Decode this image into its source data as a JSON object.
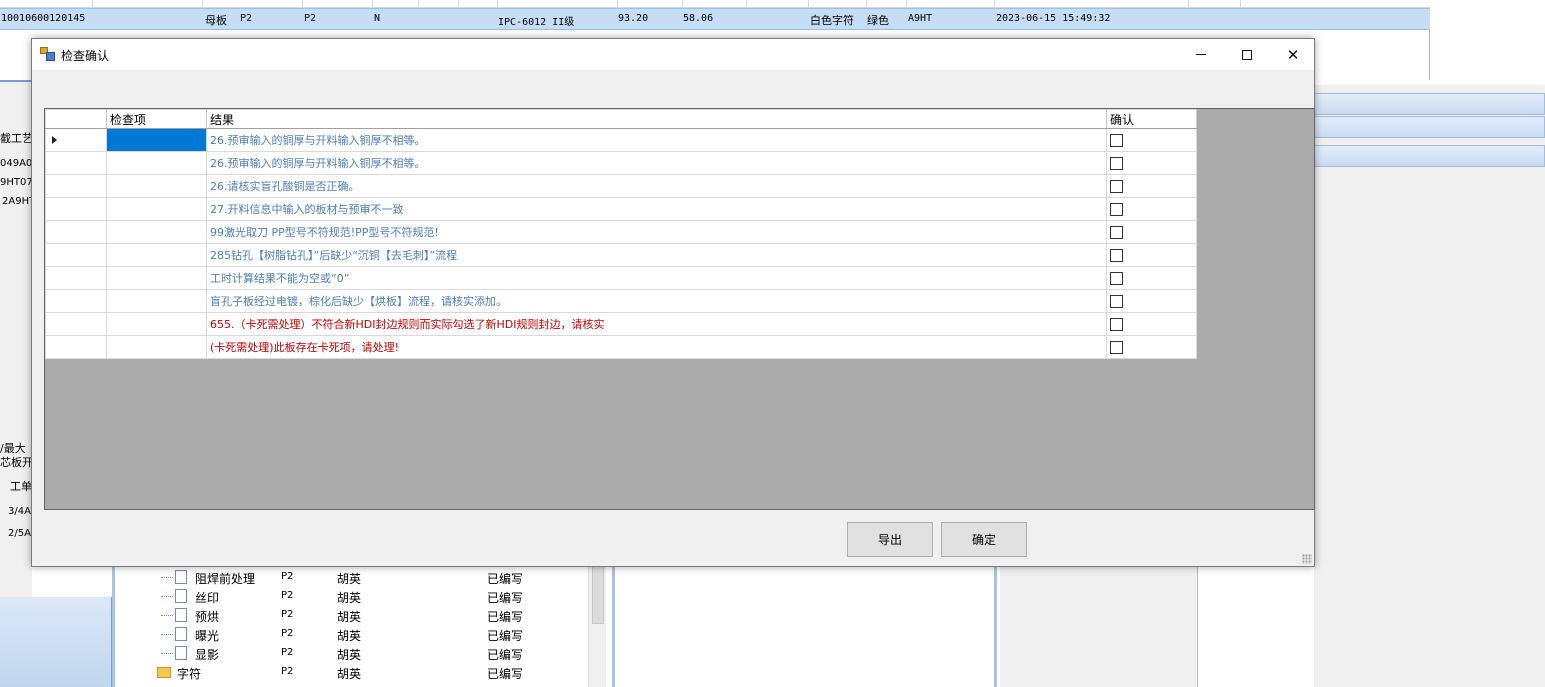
{
  "background": {
    "top_row": {
      "id": "10010600120145",
      "type": "母板",
      "c1": "P2",
      "c2": "P2",
      "c3": "N",
      "standard": "IPC-6012 II级",
      "v1": "93.20",
      "v2": "58.06",
      "ink": "白色字符",
      "color": "绿色",
      "code": "A9HT",
      "datetime": "2023-06-15 15:49:32"
    },
    "left_texts": [
      "截工艺",
      "049A0",
      "9HT07",
      "2A9HT",
      "/最大",
      "芯板开",
      "工单",
      "3/4A",
      "2/5A"
    ],
    "tree_rows": [
      {
        "label": "阻焊前处理",
        "c1": "P2",
        "c2": "胡英",
        "c3": "已编写"
      },
      {
        "label": "丝印",
        "c1": "P2",
        "c2": "胡英",
        "c3": "已编写"
      },
      {
        "label": "预烘",
        "c1": "P2",
        "c2": "胡英",
        "c3": "已编写"
      },
      {
        "label": "曝光",
        "c1": "P2",
        "c2": "胡英",
        "c3": "已编写"
      },
      {
        "label": "显影",
        "c1": "P2",
        "c2": "胡英",
        "c3": "已编写"
      },
      {
        "label": "字符",
        "c1": "P2",
        "c2": "胡英",
        "c3": "已编写"
      }
    ]
  },
  "dialog": {
    "title": "检查确认",
    "window_controls": {
      "minimize": "minimize-icon",
      "maximize": "maximize-icon",
      "close": "✕"
    },
    "grid": {
      "headers": {
        "item": "检查项",
        "result": "结果",
        "confirm": "确认"
      },
      "rows": [
        {
          "item": "",
          "result": "26.预审输入的铜厚与开料输入铜厚不相等。",
          "level": "normal",
          "checked": false
        },
        {
          "item": "",
          "result": "26.预审输入的铜厚与开料输入铜厚不相等。",
          "level": "normal",
          "checked": false
        },
        {
          "item": "",
          "result": "26.请核实盲孔酸铜是否正确。",
          "level": "normal",
          "checked": false
        },
        {
          "item": "",
          "result": "27.开料信息中输入的板材与预审不一致",
          "level": "normal",
          "checked": false
        },
        {
          "item": "",
          "result": "99激光取刀 PP型号不符规范!PP型号不符规范!",
          "level": "normal",
          "checked": false
        },
        {
          "item": "",
          "result": "285钻孔【树脂钻孔】”后缺少“沉铜【去毛刺】”流程",
          "level": "normal",
          "checked": false
        },
        {
          "item": "",
          "result": "工时计算结果不能为空或“0”",
          "level": "normal",
          "checked": false
        },
        {
          "item": "",
          "result": "盲孔子板经过电镀，棕化后缺少【烘板】流程，请核实添加。",
          "level": "normal",
          "checked": false
        },
        {
          "item": "",
          "result": "655.（卡死需处理）不符合新HDI封边规则而实际勾选了新HDI规则封边，请核实",
          "level": "alert",
          "checked": false
        },
        {
          "item": "",
          "result": "(卡死需处理)此板存在卡死项，请处理!",
          "level": "alert",
          "checked": false
        }
      ]
    },
    "buttons": {
      "export": "导出",
      "ok": "确定"
    }
  }
}
